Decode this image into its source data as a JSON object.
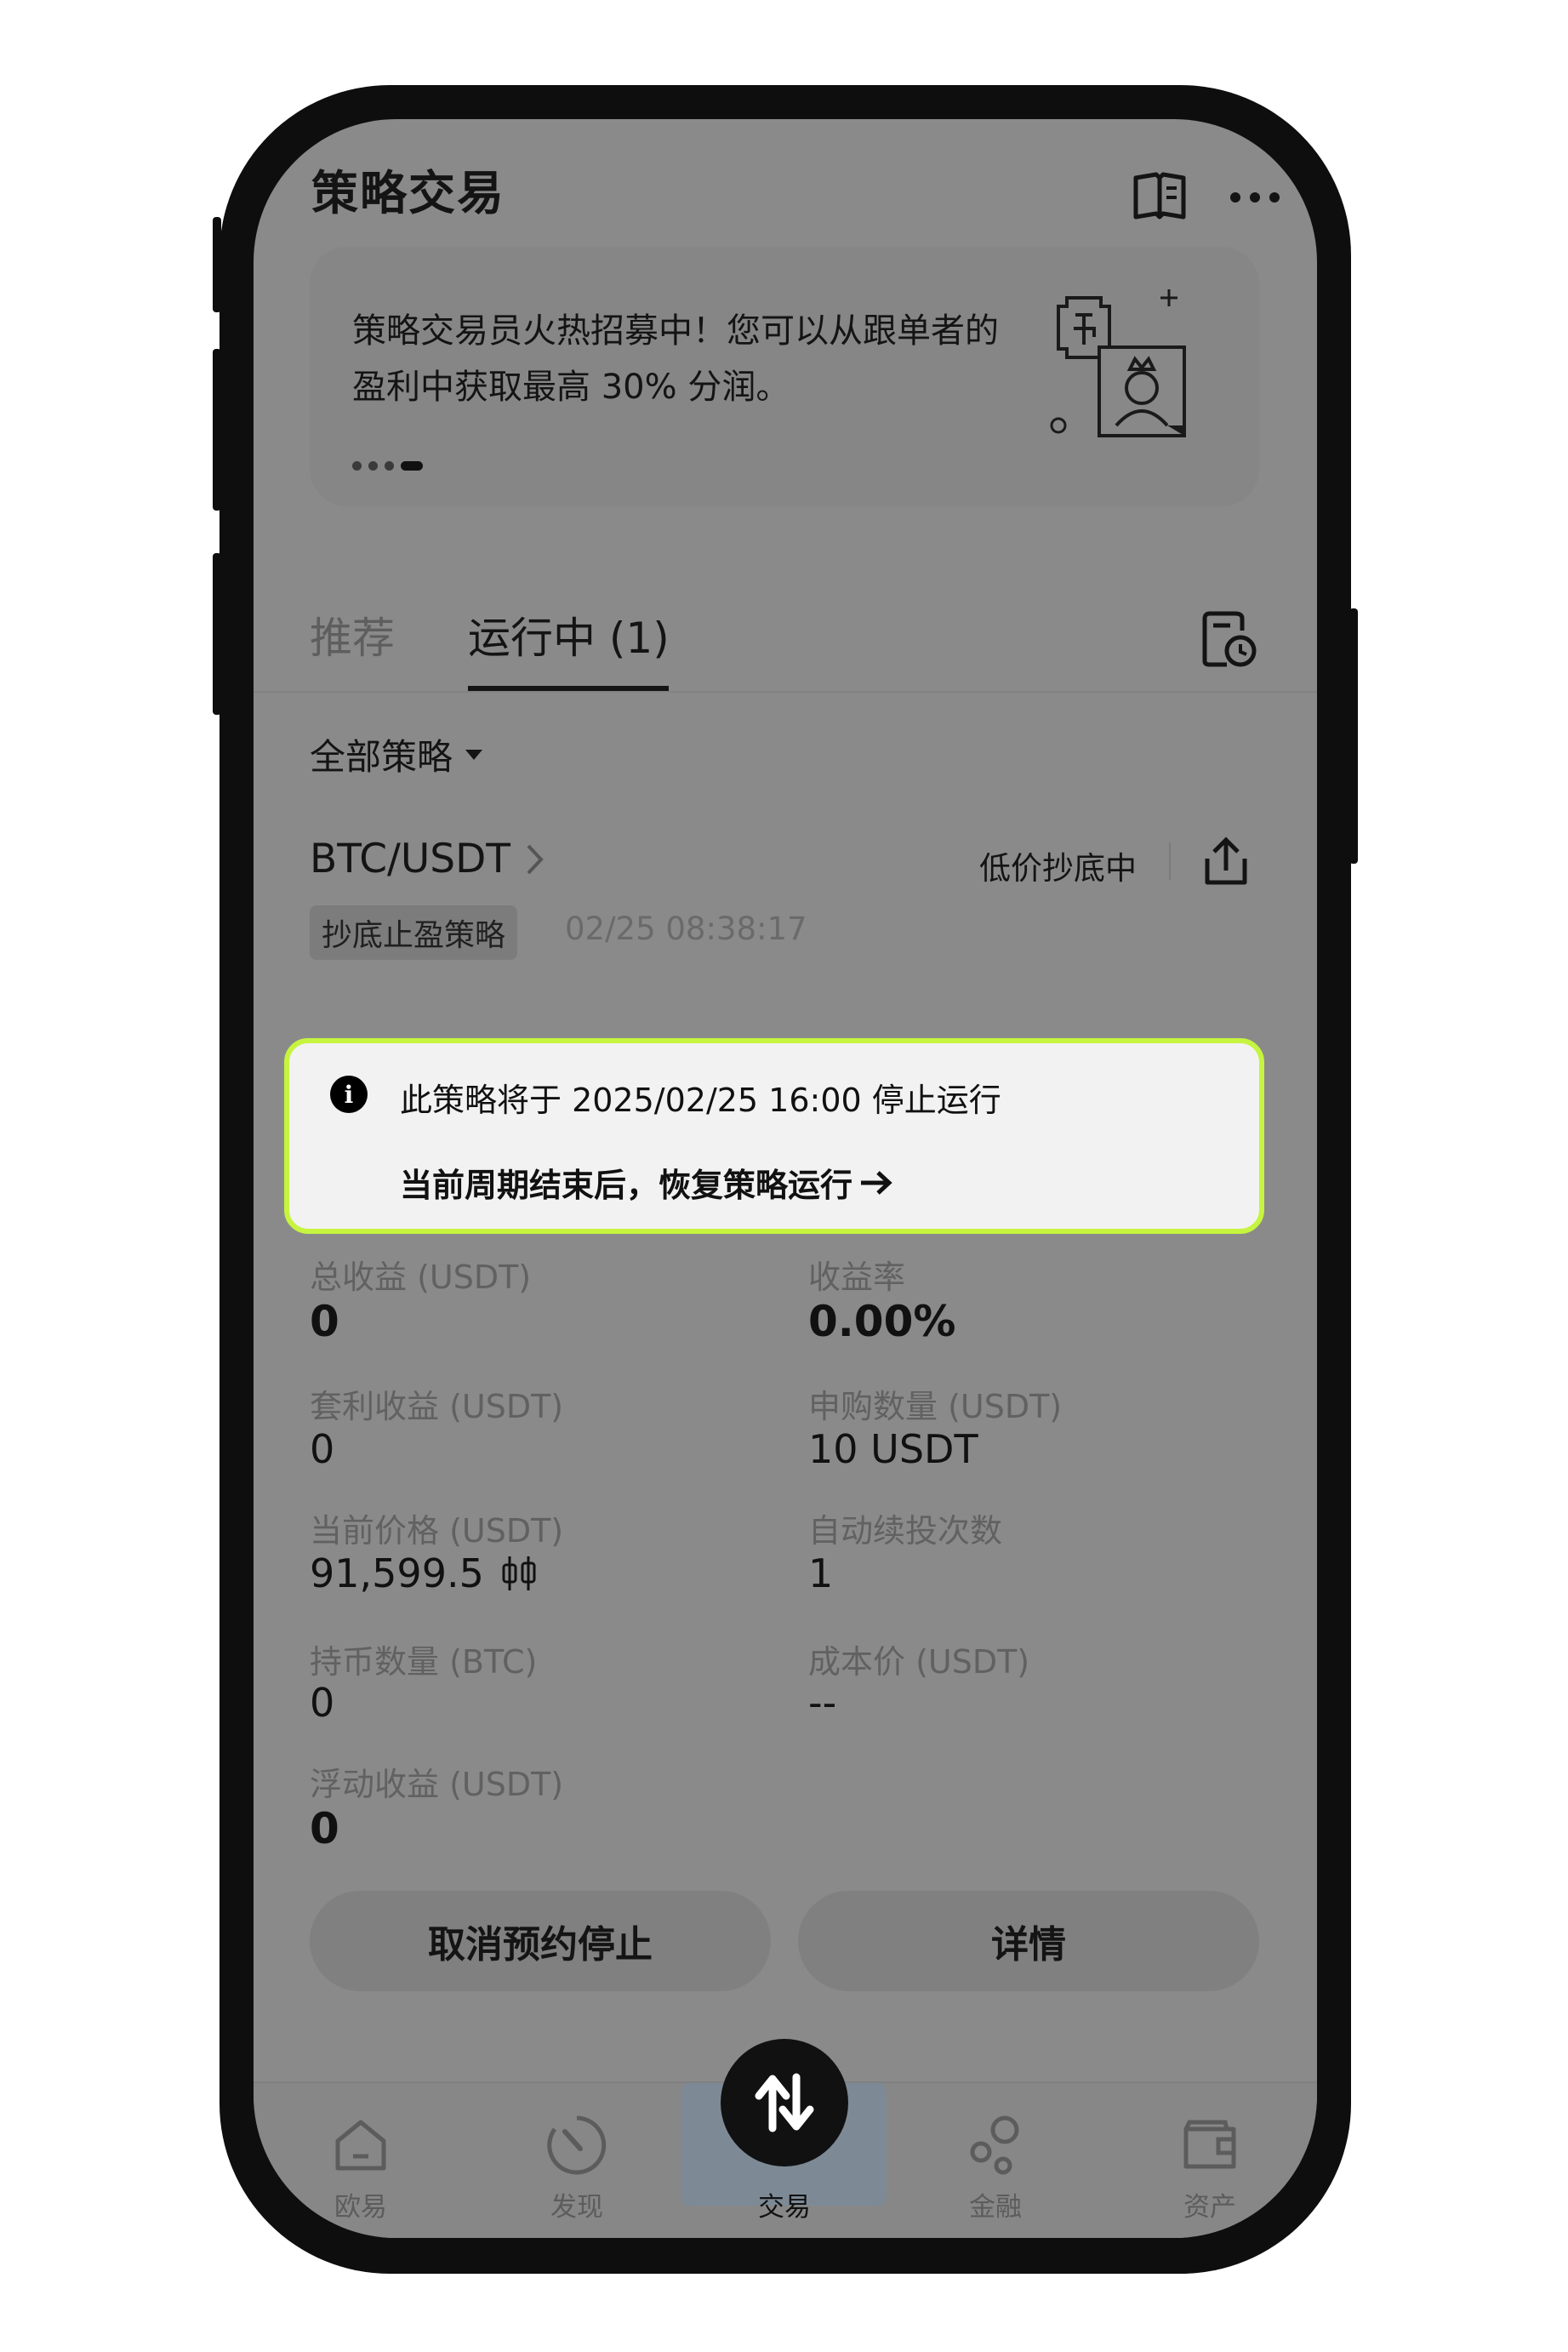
{
  "header": {
    "title": "策略交易"
  },
  "banner": {
    "text": "策略交易员火热招募中！您可以从跟单者的盈利中获取最高 30% 分润。"
  },
  "tabs": [
    {
      "label": "推荐",
      "active": false
    },
    {
      "label": "运行中 (1)",
      "active": true
    }
  ],
  "filter": {
    "label": "全部策略"
  },
  "strategy": {
    "pair": "BTC/USDT",
    "status": "低价抄底中",
    "tag": "抄底止盈策略",
    "timestamp": "02/25 08:38:17"
  },
  "notice": {
    "line1": "此策略将于 2025/02/25 16:00 停止运行",
    "line2": "当前周期结束后，恢复策略运行"
  },
  "stats": [
    {
      "label": "总收益 (USDT)",
      "value": "0"
    },
    {
      "label": "收益率",
      "value": "0.00%"
    },
    {
      "label": "套利收益 (USDT)",
      "value": "0"
    },
    {
      "label": "申购数量 (USDT)",
      "value": "10 USDT"
    },
    {
      "label": "当前价格 (USDT)",
      "value": "91,599.5"
    },
    {
      "label": "自动续投次数",
      "value": "1"
    },
    {
      "label": "持币数量 (BTC)",
      "value": "0"
    },
    {
      "label": "成本价 (USDT)",
      "value": "--"
    },
    {
      "label": "浮动收益 (USDT)",
      "value": "0"
    }
  ],
  "actions": {
    "cancel_label": "取消预约停止",
    "detail_label": "详情"
  },
  "nav": [
    {
      "label": "欧易",
      "icon": "home-icon"
    },
    {
      "label": "发现",
      "icon": "discover-icon"
    },
    {
      "label": "交易",
      "icon": "trade-icon",
      "active": true
    },
    {
      "label": "金融",
      "icon": "finance-icon"
    },
    {
      "label": "资产",
      "icon": "wallet-icon"
    }
  ],
  "colors": {
    "notice_border": "#c6f43f",
    "overlay": "#8a8a8a",
    "text": "#141414"
  }
}
